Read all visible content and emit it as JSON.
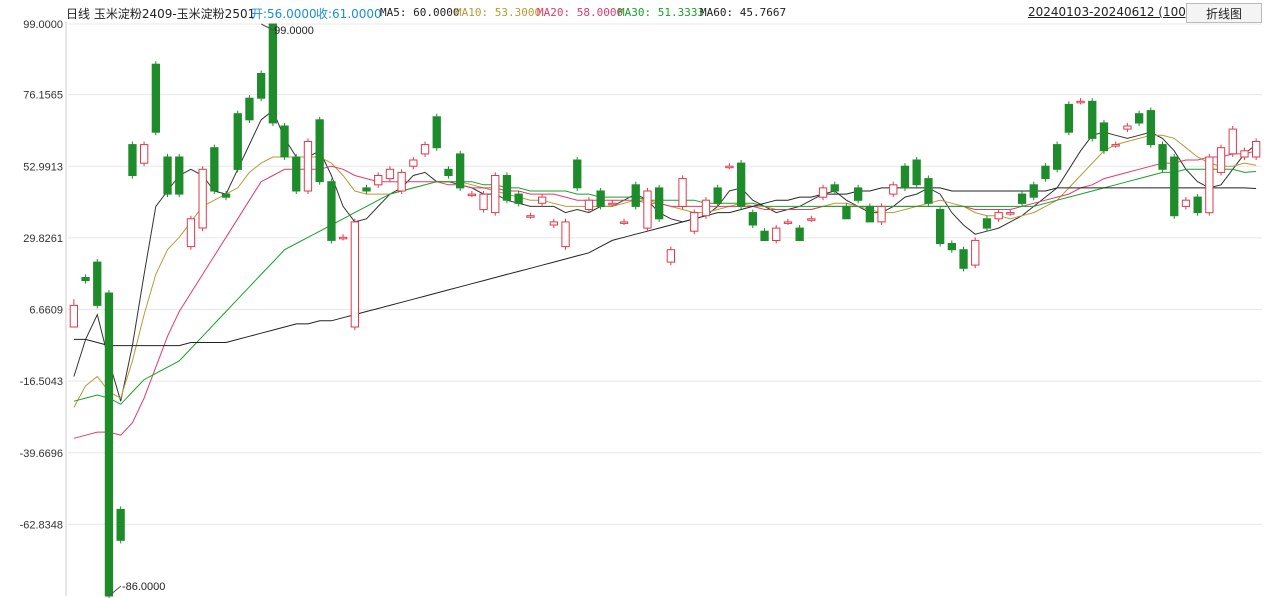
{
  "header": {
    "title": "日线  玉米淀粉2409-玉米淀粉2501",
    "open": "开:56.0000",
    "close": "收:61.0000",
    "ma5": "MA5: 60.0000",
    "ma10": "MA10: 53.3000",
    "ma20": "MA20: 58.0000",
    "ma30": "MA30: 51.3333",
    "ma60": "MA60: 45.7667",
    "range": "20240103-20240612 (100)",
    "toggle_label": "折线图"
  },
  "colors": {
    "up": "#e23a4a",
    "down": "#1e8c2a",
    "ma5": "#333333",
    "ma10": "#b79a3a",
    "ma20": "#e23a6a",
    "ma30": "#1aa02a",
    "ma60": "#222222",
    "grid": "#e8e8e8"
  },
  "chart_data": {
    "type": "candlestick",
    "ylim": [
      -86,
      99
    ],
    "y_ticks": [
      "99.0000",
      "76.1565",
      "52.9913",
      "29.8261",
      "6.6609",
      "-16.5043",
      "-39.6696",
      "-62.8348"
    ],
    "annotations": [
      {
        "text": "99.0000",
        "bar": 16,
        "value": 99
      },
      {
        "text": "-86.0000",
        "bar": 3,
        "value": -86
      }
    ],
    "candles": [
      [
        1,
        8,
        10,
        2
      ],
      [
        17,
        16,
        18,
        15
      ],
      [
        22,
        8,
        23,
        7
      ],
      [
        12,
        -86,
        13,
        -87
      ],
      [
        -58,
        -68,
        -57,
        -69
      ],
      [
        60,
        50,
        61,
        49
      ],
      [
        54,
        60,
        61,
        53
      ],
      [
        86,
        64,
        87,
        63
      ],
      [
        56,
        44,
        57,
        43
      ],
      [
        56,
        44,
        57,
        43
      ],
      [
        27,
        36,
        37,
        26
      ],
      [
        33,
        52,
        53,
        32
      ],
      [
        59,
        45,
        60,
        44
      ],
      [
        44,
        43,
        45,
        42
      ],
      [
        70,
        52,
        71,
        51
      ],
      [
        75,
        68,
        76,
        67
      ],
      [
        83,
        75,
        84,
        74
      ],
      [
        99,
        67,
        99,
        66
      ],
      [
        66,
        56,
        67,
        55
      ],
      [
        56,
        45,
        57,
        44
      ],
      [
        45,
        61,
        62,
        44
      ],
      [
        68,
        48,
        69,
        47
      ],
      [
        48,
        29,
        49,
        28
      ],
      [
        30,
        30,
        31,
        29
      ],
      [
        1,
        35,
        36,
        0
      ],
      [
        46,
        45,
        47,
        44
      ],
      [
        47,
        50,
        51,
        46
      ],
      [
        49,
        52,
        53,
        48
      ],
      [
        45,
        51,
        52,
        44
      ],
      [
        53,
        55,
        56,
        52
      ],
      [
        57,
        60,
        61,
        56
      ],
      [
        69,
        59,
        70,
        58
      ],
      [
        52,
        50,
        53,
        49
      ],
      [
        57,
        46,
        58,
        45
      ],
      [
        44,
        44,
        45,
        43
      ],
      [
        39,
        44,
        45,
        38
      ],
      [
        38,
        50,
        51,
        37
      ],
      [
        50,
        42,
        51,
        41
      ],
      [
        44,
        41,
        45,
        40
      ],
      [
        37,
        37,
        38,
        36
      ],
      [
        41,
        43,
        44,
        40
      ],
      [
        34,
        35,
        36,
        33
      ],
      [
        27,
        35,
        36,
        26
      ],
      [
        55,
        46,
        56,
        45
      ],
      [
        39,
        42,
        43,
        38
      ],
      [
        45,
        40,
        46,
        39
      ],
      [
        41,
        41,
        42,
        40
      ],
      [
        35,
        35,
        36,
        34
      ],
      [
        47,
        40,
        48,
        39
      ],
      [
        33,
        45,
        46,
        32
      ],
      [
        46,
        36,
        47,
        35
      ],
      [
        22,
        26,
        27,
        21
      ],
      [
        40,
        49,
        50,
        39
      ],
      [
        32,
        38,
        39,
        31
      ],
      [
        37,
        42,
        43,
        36
      ],
      [
        46,
        41,
        47,
        40
      ],
      [
        53,
        53,
        54,
        52
      ],
      [
        54,
        40,
        55,
        39
      ],
      [
        38,
        34,
        39,
        33
      ],
      [
        32,
        29,
        33,
        31
      ],
      [
        29,
        33,
        34,
        28
      ],
      [
        35,
        35,
        36,
        34
      ],
      [
        33,
        29,
        34,
        32
      ],
      [
        36,
        36,
        37,
        35
      ],
      [
        43,
        46,
        47,
        42
      ],
      [
        47,
        45,
        48,
        44
      ],
      [
        40,
        36,
        41,
        39
      ],
      [
        46,
        42,
        47,
        41
      ],
      [
        40,
        35,
        41,
        39
      ],
      [
        35,
        40,
        41,
        34
      ],
      [
        44,
        47,
        48,
        43
      ],
      [
        53,
        46,
        54,
        45
      ],
      [
        55,
        47,
        56,
        46
      ],
      [
        49,
        41,
        50,
        40
      ],
      [
        39,
        28,
        40,
        27
      ],
      [
        28,
        26,
        29,
        25
      ],
      [
        26,
        20,
        27,
        19
      ],
      [
        21,
        29,
        30,
        20
      ],
      [
        36,
        33,
        37,
        32
      ],
      [
        36,
        38,
        39,
        35
      ],
      [
        38,
        38,
        39,
        37
      ],
      [
        44,
        41,
        45,
        40
      ],
      [
        47,
        43,
        48,
        42
      ],
      [
        53,
        49,
        54,
        48
      ],
      [
        60,
        52,
        61,
        51
      ],
      [
        73,
        64,
        74,
        63
      ],
      [
        74,
        74,
        75,
        73
      ],
      [
        74,
        62,
        75,
        61
      ],
      [
        67,
        58,
        68,
        57
      ],
      [
        60,
        60,
        61,
        59
      ],
      [
        65,
        66,
        67,
        64
      ],
      [
        70,
        67,
        71,
        66
      ],
      [
        71,
        60,
        72,
        59
      ],
      [
        60,
        52,
        61,
        51
      ],
      [
        56,
        37,
        57,
        36
      ],
      [
        40,
        42,
        43,
        39
      ],
      [
        43,
        38,
        44,
        37
      ],
      [
        38,
        56,
        57,
        37
      ],
      [
        51,
        59,
        60,
        50
      ],
      [
        57,
        65,
        66,
        56
      ],
      [
        56,
        58,
        59,
        55
      ],
      [
        56,
        61,
        62,
        55
      ]
    ],
    "series": [
      {
        "name": "MA5",
        "values": [
          -15,
          -3,
          5,
          -10,
          -23,
          -5,
          18,
          40,
          45,
          50,
          52,
          50,
          45,
          44,
          52,
          60,
          68,
          71,
          62,
          56,
          56,
          58,
          50,
          40,
          35,
          36,
          40,
          44,
          46,
          50,
          51,
          48,
          48,
          47,
          46,
          44,
          44,
          42,
          41,
          40,
          40,
          40,
          38,
          39,
          38,
          40,
          40,
          42,
          44,
          42,
          38,
          36,
          35,
          36,
          37,
          40,
          45,
          46,
          42,
          40,
          38,
          39,
          40,
          42,
          44,
          45,
          42,
          40,
          38,
          38,
          40,
          43,
          44,
          46,
          44,
          38,
          34,
          31,
          32,
          33,
          35,
          37,
          40,
          43,
          46,
          52,
          58,
          63,
          64,
          63,
          62,
          63,
          64,
          62,
          58,
          52,
          48,
          46,
          47,
          52,
          57,
          60
        ]
      },
      {
        "name": "MA10",
        "values": [
          -25,
          -18,
          -15,
          -20,
          -22,
          -10,
          5,
          18,
          26,
          30,
          35,
          40,
          42,
          44,
          46,
          51,
          54,
          56,
          56,
          56,
          56,
          56,
          54,
          50,
          45,
          44,
          44,
          44,
          45,
          46,
          47,
          48,
          48,
          48,
          47,
          46,
          45,
          44,
          43,
          42,
          42,
          41,
          40,
          40,
          40,
          40,
          40,
          41,
          42,
          42,
          41,
          40,
          39,
          38,
          38,
          39,
          40,
          41,
          40,
          40,
          39,
          39,
          39,
          39,
          40,
          41,
          41,
          40,
          39,
          38,
          38,
          39,
          40,
          41,
          42,
          41,
          40,
          38,
          37,
          37,
          36,
          37,
          38,
          40,
          42,
          46,
          50,
          54,
          58,
          60,
          61,
          62,
          63,
          63,
          62,
          59,
          56,
          54,
          53,
          53,
          54,
          53.3
        ]
      },
      {
        "name": "MA20",
        "values": [
          -35,
          -34,
          -33,
          -33,
          -34,
          -30,
          -22,
          -12,
          -2,
          6,
          12,
          18,
          24,
          30,
          36,
          42,
          48,
          50,
          52,
          52,
          52,
          52,
          53,
          52,
          50,
          49,
          48,
          48,
          48,
          48,
          48,
          48,
          47,
          47,
          46,
          46,
          46,
          45,
          45,
          44,
          44,
          44,
          43,
          42,
          42,
          42,
          42,
          42,
          42,
          41,
          41,
          40,
          40,
          40,
          40,
          40,
          40,
          40,
          40,
          39,
          39,
          39,
          39,
          39,
          40,
          40,
          40,
          40,
          40,
          40,
          40,
          40,
          40,
          40,
          40,
          40,
          40,
          39,
          39,
          39,
          39,
          40,
          41,
          42,
          43,
          44,
          46,
          47,
          49,
          50,
          51,
          52,
          53,
          54,
          54,
          55,
          55,
          56,
          56,
          57,
          57,
          58
        ]
      },
      {
        "name": "MA30",
        "values": [
          -23,
          -22,
          -21,
          -22,
          -24,
          -20,
          -16,
          -14,
          -12,
          -10,
          -6,
          -2,
          2,
          6,
          10,
          14,
          18,
          22,
          26,
          28,
          30,
          32,
          34,
          36,
          38,
          40,
          42,
          44,
          45,
          46,
          47,
          48,
          48,
          48,
          48,
          47,
          47,
          46,
          46,
          45,
          45,
          45,
          45,
          44,
          44,
          43,
          43,
          43,
          43,
          42,
          42,
          42,
          42,
          42,
          41,
          41,
          41,
          41,
          41,
          40,
          40,
          40,
          40,
          40,
          40,
          40,
          40,
          40,
          40,
          40,
          40,
          40,
          40,
          40,
          40,
          40,
          40,
          40,
          40,
          40,
          40,
          40,
          40,
          41,
          42,
          43,
          44,
          45,
          46,
          47,
          48,
          49,
          50,
          51,
          51,
          52,
          52,
          52,
          52,
          52,
          51,
          51.3
        ]
      },
      {
        "name": "MA60",
        "values": [
          -3,
          -3,
          -4,
          -5,
          -5,
          -5,
          -5,
          -5,
          -5,
          -5,
          -4,
          -4,
          -4,
          -4,
          -3,
          -2,
          -1,
          0,
          1,
          2,
          2,
          3,
          3,
          4,
          5,
          6,
          7,
          8,
          9,
          10,
          11,
          12,
          13,
          14,
          15,
          16,
          17,
          18,
          19,
          20,
          21,
          22,
          23,
          24,
          25,
          27,
          29,
          30,
          31,
          32,
          33,
          34,
          35,
          36,
          37,
          38,
          38,
          39,
          40,
          41,
          42,
          42,
          43,
          43,
          44,
          44,
          44,
          45,
          45,
          46,
          46,
          46,
          46,
          46,
          46,
          45,
          45,
          45,
          45,
          45,
          45,
          45,
          45,
          45,
          46,
          46,
          46,
          46,
          46,
          46,
          46,
          46,
          46,
          46,
          46,
          46,
          46,
          46,
          46,
          46,
          46,
          45.8
        ]
      }
    ]
  }
}
